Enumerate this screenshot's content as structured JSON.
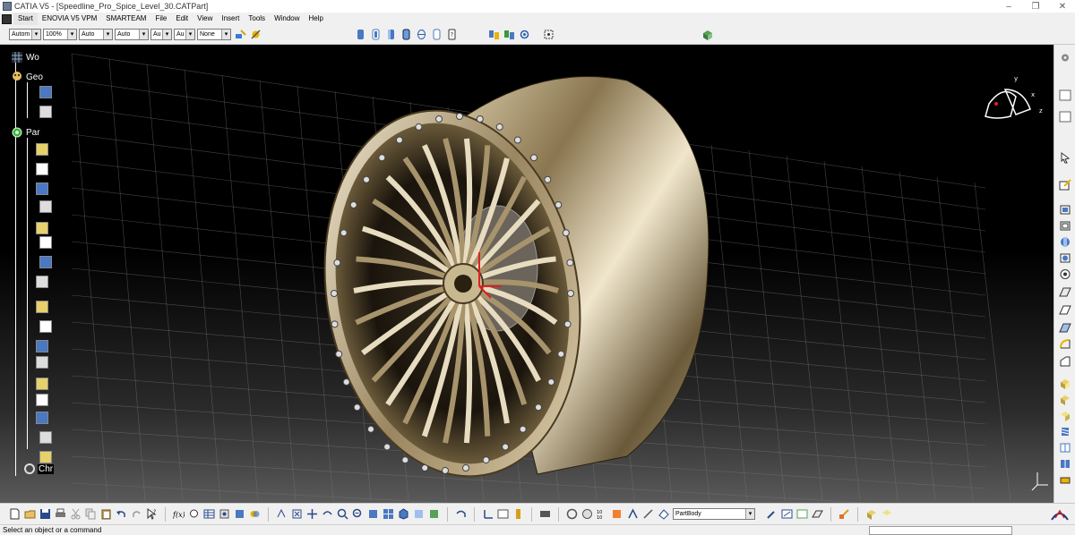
{
  "window": {
    "title": "CATIA V5 - [Speedline_Pro_Spice_Level_30.CATPart]",
    "controls": [
      "–",
      "❐",
      "✕"
    ]
  },
  "menu": [
    "Start",
    "ENOVIA V5 VPM",
    "SMARTEAM",
    "File",
    "Edit",
    "View",
    "Insert",
    "Tools",
    "Window",
    "Help"
  ],
  "graphic_properties": {
    "color": "Autom",
    "transparency": "100%",
    "line_thickness": "Auto",
    "line_type": "Auto",
    "point_type": "Au",
    "layer_left": "Au",
    "layer": "None"
  },
  "spec_tree": [
    {
      "label": "Wo",
      "icon": "grid-icon"
    },
    {
      "label": "Geo",
      "icon": "geoset-icon"
    },
    {
      "label": "Par",
      "icon": "part-icon"
    },
    {
      "label": "Chr",
      "icon": "chrome-icon"
    }
  ],
  "current_body": "PartBody",
  "status": "Select an object or a command",
  "colors": {
    "ui_bg": "#f0f0f0",
    "viewport_bg": "#000000",
    "grid": "#7a7a7a",
    "rim_light": "#e8dcc0",
    "rim_dark": "#5a4a30",
    "compass_axis": "#ffffff"
  },
  "compass_axes": [
    "x",
    "y",
    "z"
  ]
}
